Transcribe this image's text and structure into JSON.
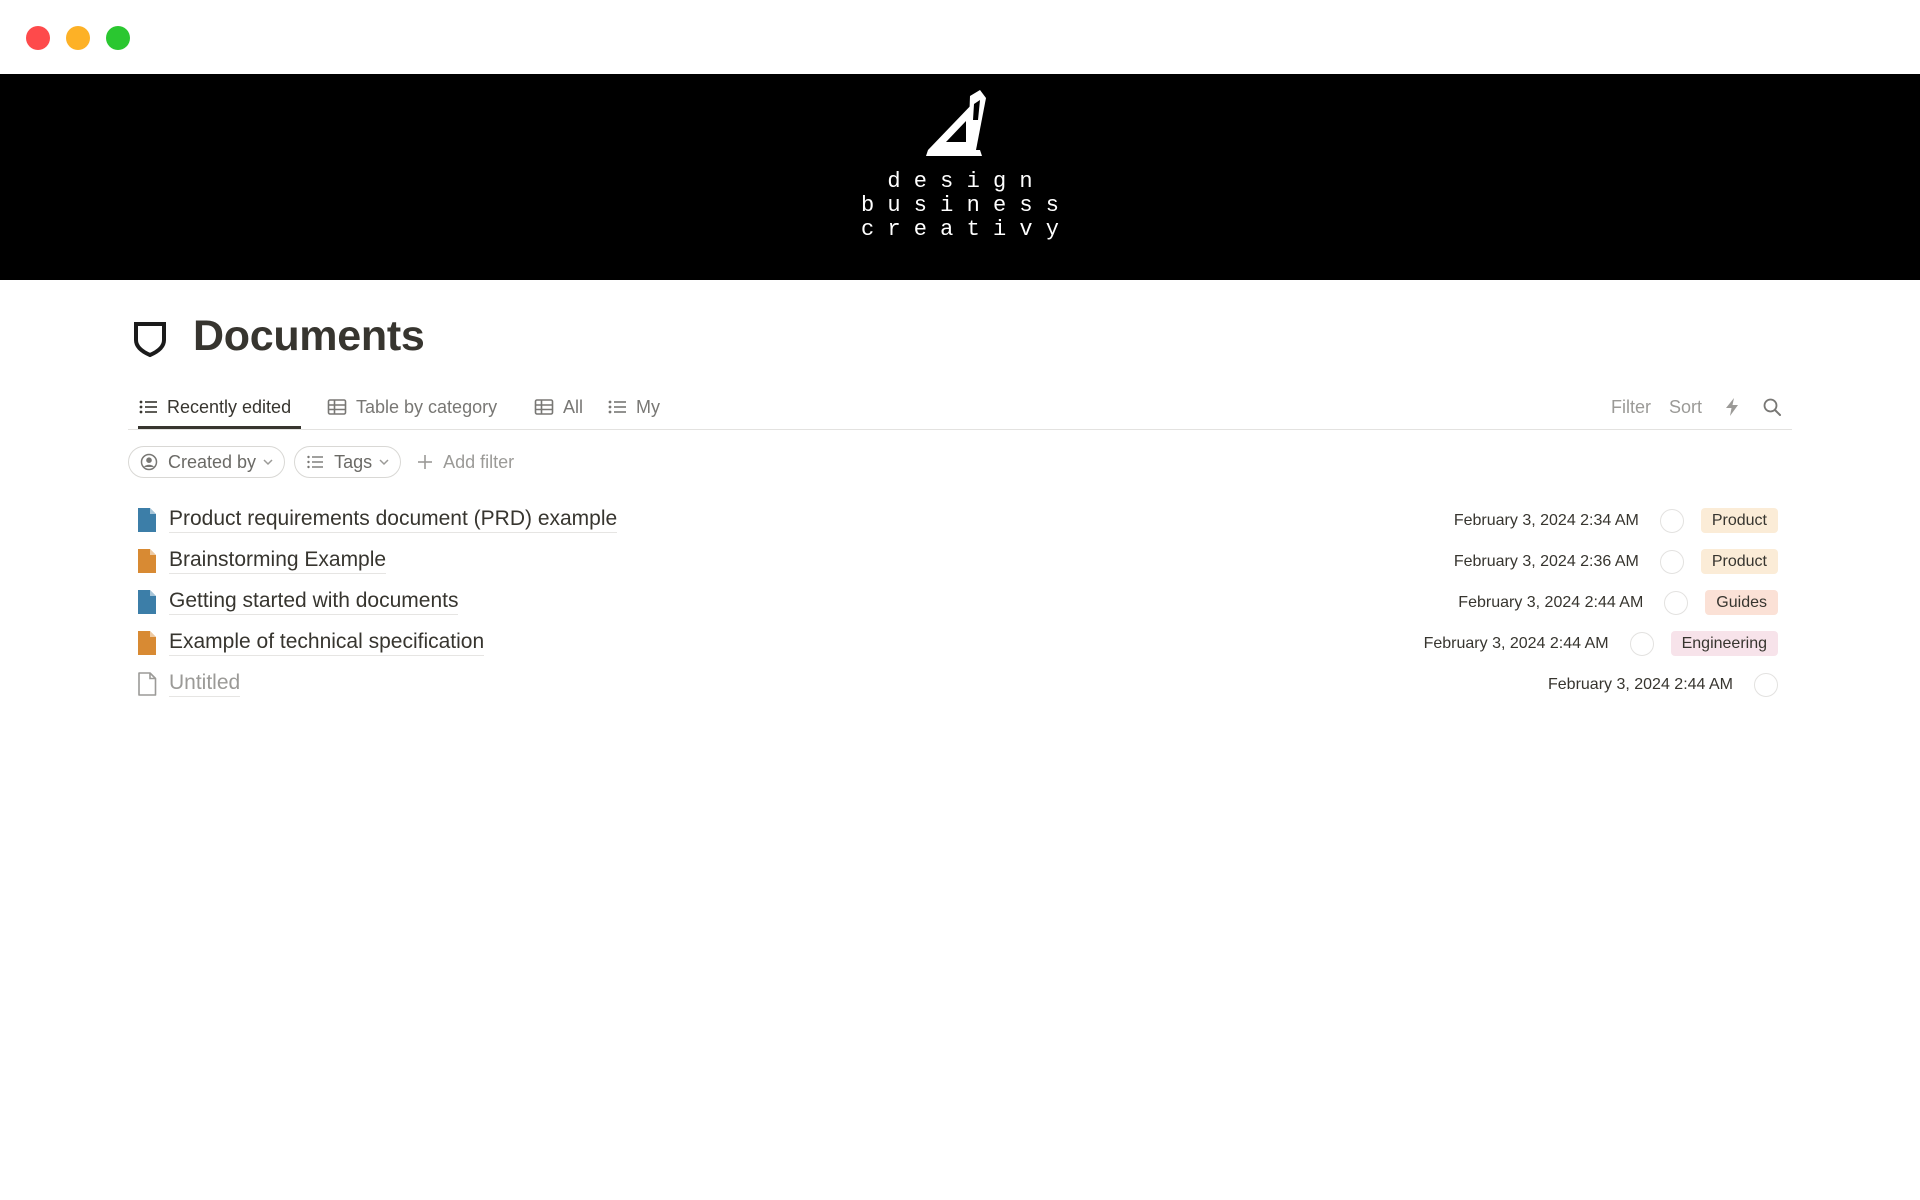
{
  "window": {
    "controls": [
      "close",
      "minimize",
      "maximize"
    ]
  },
  "cover": {
    "logo_icon": "set-square-pencil-logo",
    "logo_lines": [
      "d e s i g n",
      "b u s i n e s s",
      "c r e a t i v y"
    ]
  },
  "page": {
    "icon": "shield-outline-icon",
    "title": "Documents"
  },
  "tabs": [
    {
      "label": "Recently edited",
      "icon": "list-icon",
      "active": true
    },
    {
      "label": "Table by category",
      "icon": "table-icon",
      "active": false
    },
    {
      "label": "All",
      "icon": "table-icon",
      "active": false
    },
    {
      "label": "My",
      "icon": "list-icon",
      "active": false
    }
  ],
  "toolbar": {
    "filter_label": "Filter",
    "sort_label": "Sort",
    "automation_icon": "lightning-icon",
    "search_icon": "search-icon"
  },
  "filters": {
    "created_by_label": "Created by",
    "tags_label": "Tags",
    "add_filter_label": "Add filter"
  },
  "documents": [
    {
      "title": "Product requirements document (PRD) example",
      "icon_color": "#3c7ea8",
      "edited": "February 3, 2024 2:34 AM",
      "tag": "Product",
      "tag_color": "#fbecd7"
    },
    {
      "title": "Brainstorming Example",
      "icon_color": "#d88a33",
      "edited": "February 3, 2024 2:36 AM",
      "tag": "Product",
      "tag_color": "#fbecd7"
    },
    {
      "title": "Getting started with documents",
      "icon_color": "#3c7ea8",
      "edited": "February 3, 2024 2:44 AM",
      "tag": "Guides",
      "tag_color": "#fbe1d6"
    },
    {
      "title": "Example of technical specification",
      "icon_color": "#d88a33",
      "edited": "February 3, 2024 2:44 AM",
      "tag": "Engineering",
      "tag_color": "#f7e3ea"
    },
    {
      "title": "Untitled",
      "icon_color": "#9b9a97",
      "edited": "February 3, 2024 2:44 AM",
      "tag": "",
      "tag_color": ""
    }
  ]
}
